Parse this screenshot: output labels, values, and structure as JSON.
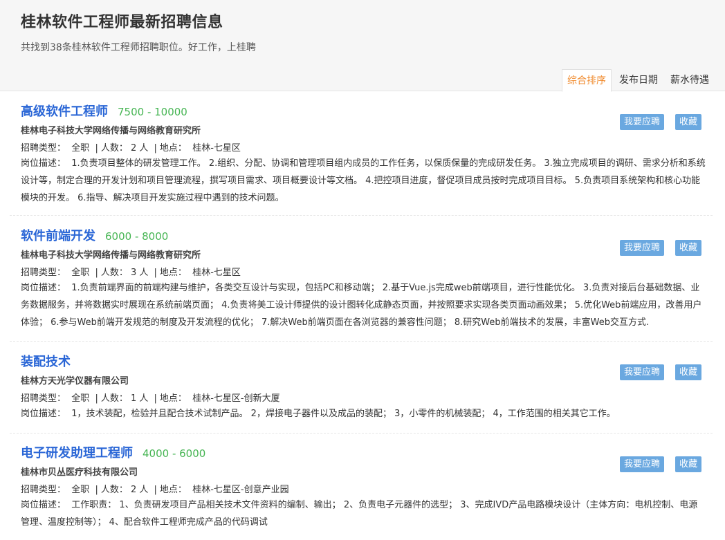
{
  "header": {
    "title": "桂林软件工程师最新招聘信息",
    "subtitle": "共找到38条桂林软件工程师招聘职位。好工作，上桂聘"
  },
  "sort_tabs": [
    {
      "label": "综合排序",
      "active": true
    },
    {
      "label": "发布日期",
      "active": false
    },
    {
      "label": "薪水待遇",
      "active": false
    }
  ],
  "jobs": [
    {
      "title": "高级软件工程师",
      "salary": "7500 - 10000",
      "company": "桂林电子科技大学网络传播与网络教育研究所",
      "type_label": "招聘类型：",
      "type": "全职",
      "count_label": "人数：",
      "count": "2 人",
      "location_label": "地点：",
      "location": "桂林-七星区",
      "desc_label": "岗位描述：",
      "desc": "1.负责项目整体的研发管理工作。 2.组织、分配、协调和管理项目组内成员的工作任务，以保质保量的完成研发任务。 3.独立完成项目的调研、需求分析和系统设计等，制定合理的开发计划和项目管理流程，撰写项目需求、项目概要设计等文档。 4.把控项目进度，督促项目成员按时完成项目目标。 5.负责项目系统架构和核心功能模块的开发。 6.指导、解决项目开发实施过程中遇到的技术问题。",
      "apply_label": "我要应聘",
      "fav_label": "收藏"
    },
    {
      "title": "软件前端开发",
      "salary": "6000 - 8000",
      "company": "桂林电子科技大学网络传播与网络教育研究所",
      "type_label": "招聘类型：",
      "type": "全职",
      "count_label": "人数：",
      "count": "3 人",
      "location_label": "地点：",
      "location": "桂林-七星区",
      "desc_label": "岗位描述：",
      "desc": "1.负责前端界面的前端构建与维护，各类交互设计与实现，包括PC和移动端； 2.基于Vue.js完成web前端项目，进行性能优化。 3.负责对接后台基础数据、业务数据服务，并将数据实时展现在系统前端页面； 4.负责将美工设计师提供的设计图转化成静态页面，并按照要求实现各类页面动画效果； 5.优化Web前端应用，改善用户体验； 6.参与Web前端开发规范的制度及开发流程的优化； 7.解决Web前端页面在各浏览器的兼容性问题； 8.研究Web前端技术的发展，丰富Web交互方式.",
      "apply_label": "我要应聘",
      "fav_label": "收藏"
    },
    {
      "title": "装配技术",
      "salary": "",
      "company": "桂林方天光学仪器有限公司",
      "type_label": "招聘类型：",
      "type": "全职",
      "count_label": "人数：",
      "count": "1 人",
      "location_label": "地点：",
      "location": "桂林-七星区-创新大厦",
      "desc_label": "岗位描述：",
      "desc": "1，技术装配，检验并且配合技术试制产品。 2，焊接电子器件以及成品的装配； 3，小零件的机械装配； 4，工作范围的相关其它工作。",
      "apply_label": "我要应聘",
      "fav_label": "收藏"
    },
    {
      "title": "电子研发助理工程师",
      "salary": "4000 - 6000",
      "company": "桂林市贝丛医疗科技有限公司",
      "type_label": "招聘类型：",
      "type": "全职",
      "count_label": "人数：",
      "count": "2 人",
      "location_label": "地点：",
      "location": "桂林-七星区-创意产业园",
      "desc_label": "岗位描述：",
      "desc": "工作职责： 1、负责研发项目产品相关技术文件资料的编制、输出； 2、负责电子元器件的选型； 3、完成IVD产品电路模块设计（主体方向：电机控制、电源管理、温度控制等）； 4、配合软件工程师完成产品的代码调试",
      "apply_label": "我要应聘",
      "fav_label": "收藏"
    }
  ]
}
